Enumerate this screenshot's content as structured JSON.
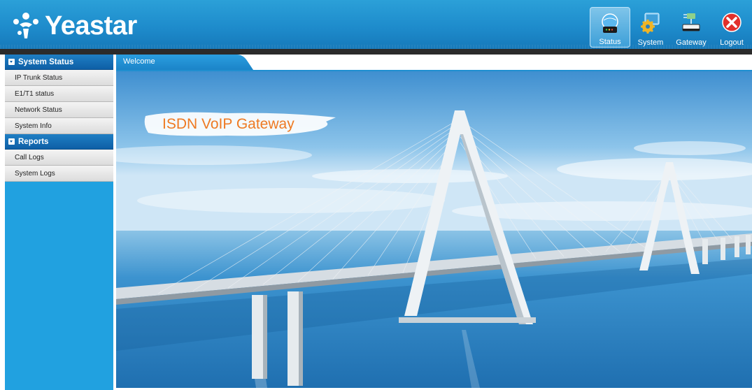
{
  "app": {
    "logo_text": "Yeastar"
  },
  "nav": [
    {
      "label": "Status",
      "icon": "status-globe-icon",
      "active": true
    },
    {
      "label": "System",
      "icon": "system-monitor-gear-icon",
      "active": false
    },
    {
      "label": "Gateway",
      "icon": "gateway-device-icon",
      "active": false
    },
    {
      "label": "Logout",
      "icon": "logout-close-icon",
      "active": false
    }
  ],
  "sidebar": {
    "sections": [
      {
        "title": "System Status",
        "items": [
          "IP Trunk Status",
          "E1/T1 status",
          "Network Status",
          "System Info"
        ]
      },
      {
        "title": "Reports",
        "items": [
          "Call Logs",
          "System Logs"
        ]
      }
    ]
  },
  "main": {
    "tab_label": "Welcome",
    "banner_title": "ISDN VoIP Gateway"
  },
  "colors": {
    "header_blue": "#1e8ccc",
    "sidebar_blue": "#21a1e0",
    "banner_title_orange": "#ee7a22"
  }
}
